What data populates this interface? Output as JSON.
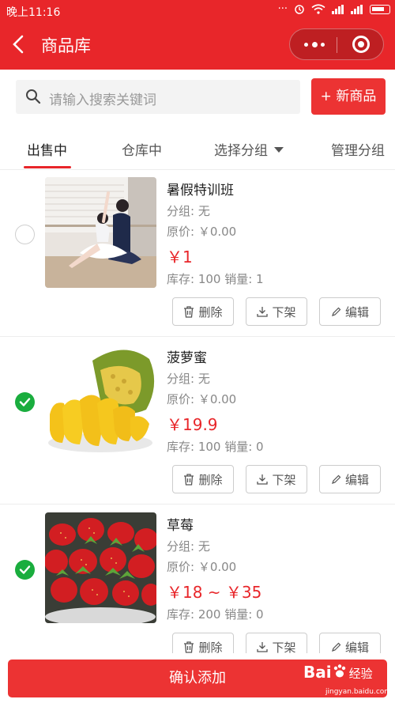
{
  "status_bar": {
    "time": "晚上11:16",
    "dots": "···"
  },
  "header": {
    "back_icon": "chevron-left-icon",
    "title": "商品库"
  },
  "search": {
    "placeholder": "请输入搜索关键词",
    "new_button": "+ 新商品"
  },
  "tabs": [
    {
      "label": "出售中",
      "active": true
    },
    {
      "label": "仓库中",
      "active": false
    },
    {
      "label": "选择分组",
      "active": false
    },
    {
      "label": "管理分组",
      "active": false
    }
  ],
  "products": [
    {
      "name": "暑假特训班",
      "group": "分组: 无",
      "original_price": "原价: ￥0.00",
      "price": "￥1",
      "stock": "库存: 100   销量: 1",
      "checked": false
    },
    {
      "name": "菠萝蜜",
      "group": "分组: 无",
      "original_price": "原价: ￥0.00",
      "price": "￥19.9",
      "stock": "库存: 100   销量: 0",
      "checked": true
    },
    {
      "name": "草莓",
      "group": "分组: 无",
      "original_price": "原价: ￥0.00",
      "price": "￥18 ~ ￥35",
      "stock": "库存: 200   销量: 0",
      "checked": true
    }
  ],
  "actions": {
    "delete": "删除",
    "unlist": "下架",
    "edit": "编辑"
  },
  "footer": {
    "confirm": "确认添加",
    "watermark": "Bai",
    "watermark_suffix": "经验",
    "watermark_url": "jingyan.baidu.com"
  },
  "colors": {
    "brand_red": "#e8262a",
    "check_green": "#1aad3e"
  }
}
